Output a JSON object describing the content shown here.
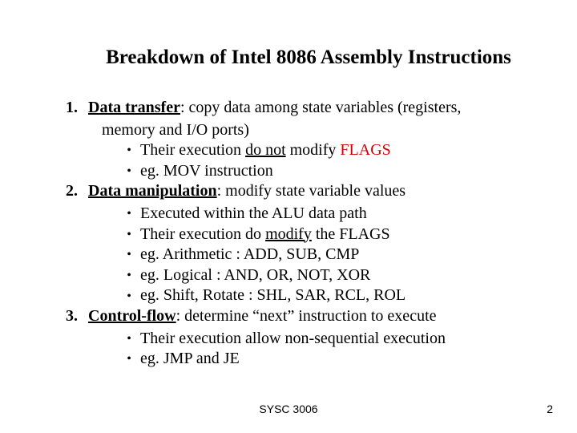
{
  "title": "Breakdown of Intel 8086 Assembly Instructions",
  "items": {
    "i1": {
      "num": "1.",
      "head": "Data transfer",
      "rest1": ":  copy data among state variables (registers,",
      "rest2": "memory and I/O ports)",
      "b1_pre": "Their execution ",
      "b1_un": "do not",
      "b1_post": " modify ",
      "b1_red": "FLAGS",
      "b2": "eg. MOV instruction"
    },
    "i2": {
      "num": "2.",
      "head": "Data manipulation",
      "rest1": ": modify state variable values",
      "b1": "Executed within the ALU data path",
      "b2_pre": "Their execution do ",
      "b2_un": "modify",
      "b2_post": " the FLAGS",
      "b3": "eg. Arithmetic : ADD, SUB, CMP",
      "b4": "eg. Logical : AND, OR, NOT, XOR",
      "b5": "eg. Shift, Rotate : SHL, SAR, RCL, ROL"
    },
    "i3": {
      "num": "3.",
      "head": "Control-flow",
      "rest1": ": determine “next” instruction to execute",
      "b1": "Their execution allow non-sequential execution",
      "b2": "eg. JMP and JE"
    }
  },
  "footer": {
    "center": "SYSC 3006",
    "page": "2"
  }
}
